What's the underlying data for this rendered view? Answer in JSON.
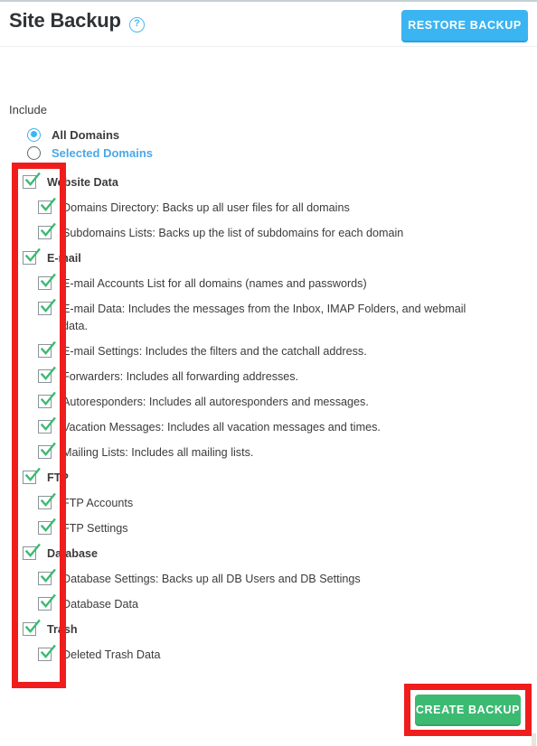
{
  "header": {
    "title": "Site Backup",
    "help_icon": "question-circle-icon",
    "help_glyph": "?",
    "restore_button": "RESTORE BACKUP"
  },
  "include": {
    "label": "Include",
    "options": [
      {
        "label": "All Domains",
        "selected": true,
        "is_link": false
      },
      {
        "label": "Selected Domains",
        "selected": false,
        "is_link": true
      }
    ]
  },
  "tree": [
    {
      "level": 0,
      "label": "Website Data",
      "checked": true,
      "wrap": false
    },
    {
      "level": 1,
      "label": "Domains Directory: Backs up all user files for all domains",
      "checked": true,
      "wrap": false
    },
    {
      "level": 1,
      "label": "Subdomains Lists: Backs up the list of subdomains for each domain",
      "checked": true,
      "wrap": false
    },
    {
      "level": 0,
      "label": "E-mail",
      "checked": true,
      "wrap": false
    },
    {
      "level": 1,
      "label": "E-mail Accounts List for all domains (names and passwords)",
      "checked": true,
      "wrap": false
    },
    {
      "level": 1,
      "label": "E-mail Data: Includes the messages from the Inbox, IMAP Folders, and webmail data.",
      "checked": true,
      "wrap": true
    },
    {
      "level": 1,
      "label": "E-mail Settings: Includes the filters and the catchall address.",
      "checked": true,
      "wrap": false
    },
    {
      "level": 1,
      "label": "Forwarders: Includes all forwarding addresses.",
      "checked": true,
      "wrap": false
    },
    {
      "level": 1,
      "label": "Autoresponders: Includes all autoresponders and messages.",
      "checked": true,
      "wrap": false
    },
    {
      "level": 1,
      "label": "Vacation Messages: Includes all vacation messages and times.",
      "checked": true,
      "wrap": false
    },
    {
      "level": 1,
      "label": "Mailing Lists: Includes all mailing lists.",
      "checked": true,
      "wrap": false
    },
    {
      "level": 0,
      "label": "FTP",
      "checked": true,
      "wrap": false
    },
    {
      "level": 1,
      "label": "FTP Accounts",
      "checked": true,
      "wrap": false
    },
    {
      "level": 1,
      "label": "FTP Settings",
      "checked": true,
      "wrap": false
    },
    {
      "level": 0,
      "label": "Database",
      "checked": true,
      "wrap": false
    },
    {
      "level": 1,
      "label": "Database Settings: Backs up all DB Users and DB Settings",
      "checked": true,
      "wrap": false
    },
    {
      "level": 1,
      "label": "Database Data",
      "checked": true,
      "wrap": false
    },
    {
      "level": 0,
      "label": "Trash",
      "checked": true,
      "wrap": false
    },
    {
      "level": 1,
      "label": "Deleted Trash Data",
      "checked": true,
      "wrap": false
    }
  ],
  "footer": {
    "create_button": "CREATE BACKUP"
  },
  "annotations": [
    {
      "name": "checkbox-column-highlight"
    },
    {
      "name": "create-backup-highlight"
    }
  ],
  "colors": {
    "restore_blue": "#3bb4f2",
    "create_green": "#3cba72",
    "link_blue": "#4aa8e8",
    "check_green": "#3cba72",
    "annotation_red": "#f01d1d",
    "text": "#3b3b3b"
  }
}
